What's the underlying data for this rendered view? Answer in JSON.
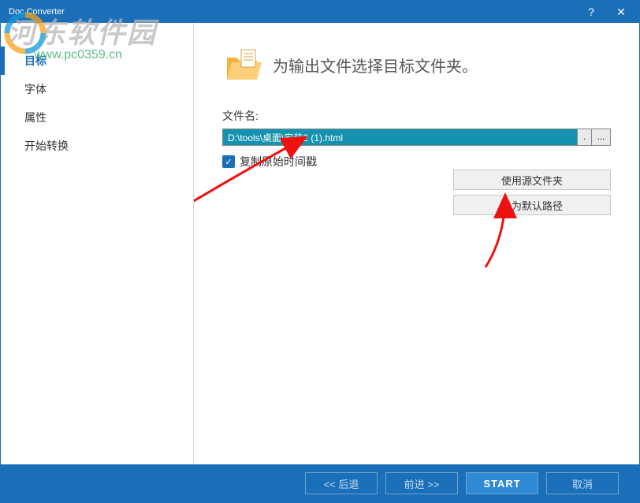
{
  "window": {
    "title": "Doc Converter"
  },
  "sidebar": {
    "items": [
      {
        "label": "目标",
        "active": true
      },
      {
        "label": "字体"
      },
      {
        "label": "属性"
      },
      {
        "label": "开始转换"
      }
    ]
  },
  "main": {
    "heading": "为输出文件选择目标文件夹。",
    "filename_label": "文件名:",
    "filename_value": "D:\\tools\\桌面\\安装2 (1).html",
    "dots_btn": ".",
    "browse_btn": "...",
    "checkbox_label": "复制原始时间戳",
    "checkbox_checked": true,
    "side_buttons": [
      "使用源文件夹",
      "设为默认路径"
    ]
  },
  "footer": {
    "back": "<< 后退",
    "next": "前进 >>",
    "start": "START",
    "cancel": "取消"
  },
  "watermark": {
    "text": "河东软件园",
    "url": "www.pc0359.cn"
  }
}
